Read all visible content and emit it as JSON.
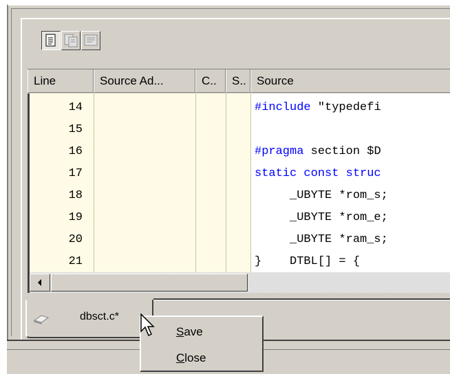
{
  "header": {
    "columns": [
      "Line",
      "Source Ad...",
      "C..",
      "S..",
      "Source"
    ]
  },
  "rows": [
    {
      "line": "14",
      "kw": "#include",
      "rest": " \"typedefi"
    },
    {
      "line": "15",
      "kw": "",
      "rest": ""
    },
    {
      "line": "16",
      "kw": "#pragma",
      "rest": " section $D"
    },
    {
      "line": "17",
      "kw": "static const struc",
      "rest": ""
    },
    {
      "line": "18",
      "kw": "",
      "rest": "     _UBYTE *rom_s;"
    },
    {
      "line": "19",
      "kw": "",
      "rest": "     _UBYTE *rom_e;"
    },
    {
      "line": "20",
      "kw": "",
      "rest": "     _UBYTE *ram_s;"
    },
    {
      "line": "21",
      "kw": "",
      "rest": "}    DTBL[] = {"
    }
  ],
  "tab": {
    "label": "dbsct.c*"
  },
  "context_menu": {
    "items": [
      {
        "label": "Save",
        "mnemonic": "S",
        "rest": "ave"
      },
      {
        "label": "Close",
        "mnemonic": "C",
        "rest": "lose"
      }
    ]
  },
  "colors": {
    "keyword": "#0000ff",
    "grid_bg": "#fffbe6",
    "face": "#d4d0c8"
  }
}
